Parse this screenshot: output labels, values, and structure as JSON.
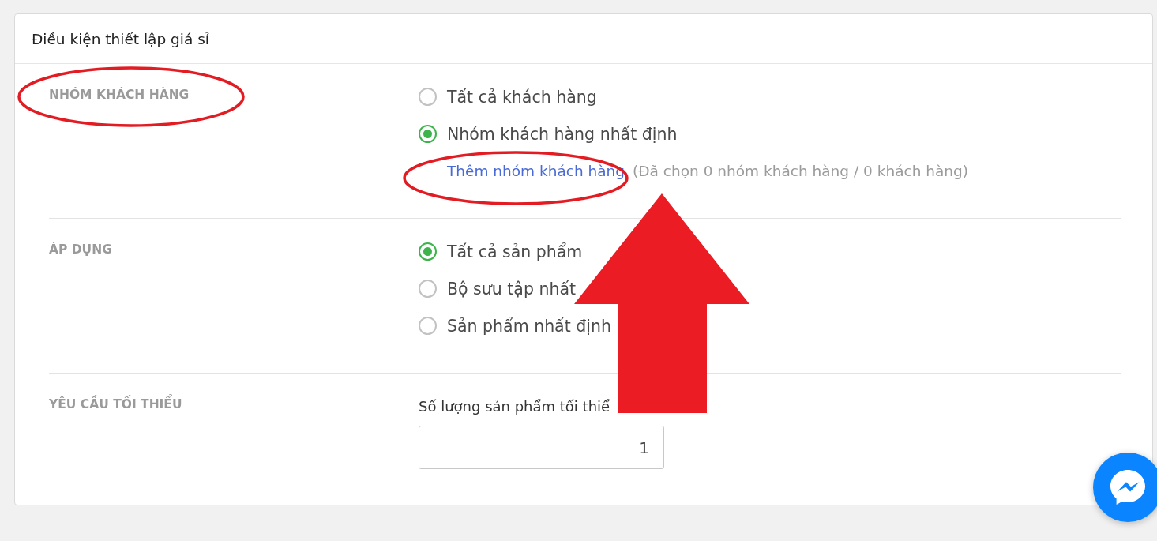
{
  "card": {
    "title": "Điều kiện thiết lập giá sỉ"
  },
  "sections": [
    {
      "kind": "radio_group",
      "label": "NHÓM KHÁCH HÀNG",
      "circled": true,
      "options": [
        {
          "label": "Tất cả khách hàng",
          "selected": false
        },
        {
          "label": "Nhóm khách hàng nhất định",
          "selected": true
        }
      ],
      "link": {
        "text": "Thêm nhóm khách hàng",
        "circled": true
      },
      "note": "(Đã chọn 0 nhóm khách hàng / 0 khách hàng)"
    },
    {
      "kind": "radio_group",
      "label": "ÁP DỤNG",
      "circled": false,
      "options": [
        {
          "label": "Tất cả sản phẩm",
          "selected": true
        },
        {
          "label": "Bộ sưu tập nhất",
          "selected": false
        },
        {
          "label": "Sản phẩm nhất định",
          "selected": false
        }
      ]
    },
    {
      "kind": "number_field",
      "label": "YÊU CẦU TỐI THIỂU",
      "circled": false,
      "field_label": "Số lượng sản phẩm tối thiể",
      "value": "1"
    }
  ],
  "annotations": [
    {
      "kind": "arrow"
    }
  ]
}
